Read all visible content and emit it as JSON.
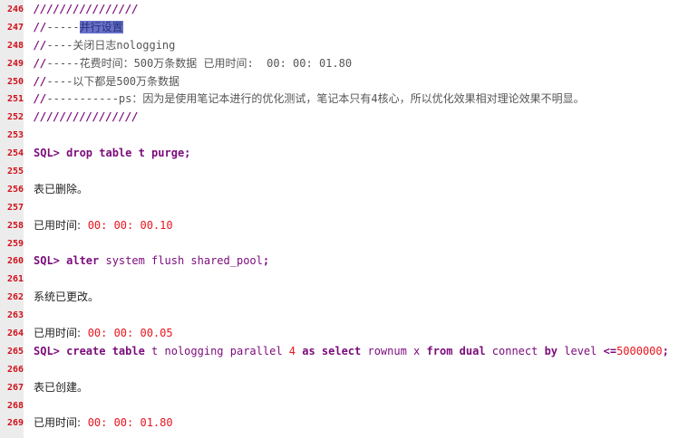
{
  "colors": {
    "keyword": "#7b0b7b",
    "number": "#e8141e",
    "line_number": "#d0101a",
    "gutter": "#ececec",
    "selection": "#6671c9"
  },
  "lines": [
    {
      "n": "246",
      "seg": [
        [
          "cm",
          "////////////////"
        ]
      ]
    },
    {
      "n": "247",
      "seg": [
        [
          "cm",
          "//"
        ],
        [
          "ct",
          "-----"
        ],
        [
          "hl",
          "并行设置"
        ]
      ]
    },
    {
      "n": "248",
      "seg": [
        [
          "cm",
          "//"
        ],
        [
          "ct",
          "----关闭日志nologging"
        ]
      ]
    },
    {
      "n": "249",
      "seg": [
        [
          "cm",
          "//"
        ],
        [
          "ct",
          "-----花费时间：500万条数据 已用时间:  00: 00: 01.80"
        ]
      ]
    },
    {
      "n": "250",
      "seg": [
        [
          "cm",
          "//"
        ],
        [
          "ct",
          "----以下都是500万条数据"
        ]
      ]
    },
    {
      "n": "251",
      "seg": [
        [
          "cm",
          "//"
        ],
        [
          "ct",
          "-----------ps：因为是使用笔记本进行的优化测试，笔记本只有4核心，所以优化效果相对理论效果不明显。"
        ]
      ]
    },
    {
      "n": "252",
      "seg": [
        [
          "cm",
          "////////////////"
        ]
      ]
    },
    {
      "n": "253",
      "seg": []
    },
    {
      "n": "254",
      "seg": [
        [
          "kw",
          "SQL> drop table t purge;"
        ]
      ]
    },
    {
      "n": "255",
      "seg": []
    },
    {
      "n": "256",
      "seg": [
        [
          "pl",
          "表已删除。"
        ]
      ]
    },
    {
      "n": "257",
      "seg": []
    },
    {
      "n": "258",
      "seg": [
        [
          "pl",
          "已用时间:  "
        ],
        [
          "num",
          "00: 00: 00.10"
        ]
      ]
    },
    {
      "n": "259",
      "seg": []
    },
    {
      "n": "260",
      "seg": [
        [
          "kw",
          "SQL> alter "
        ],
        [
          "id",
          "system flush shared_pool"
        ],
        [
          "kw",
          ";"
        ]
      ]
    },
    {
      "n": "261",
      "seg": []
    },
    {
      "n": "262",
      "seg": [
        [
          "pl",
          "系统已更改。"
        ]
      ]
    },
    {
      "n": "263",
      "seg": []
    },
    {
      "n": "264",
      "seg": [
        [
          "pl",
          "已用时间:  "
        ],
        [
          "num",
          "00: 00: 00.05"
        ]
      ]
    },
    {
      "n": "265",
      "seg": [
        [
          "kw",
          "SQL> create table "
        ],
        [
          "id",
          "t nologging parallel "
        ],
        [
          "num",
          "4"
        ],
        [
          "kw",
          " as select "
        ],
        [
          "id",
          "rownum x "
        ],
        [
          "kw",
          "from dual "
        ],
        [
          "id",
          "connect "
        ],
        [
          "kw",
          "by "
        ],
        [
          "id",
          "level "
        ],
        [
          "kw",
          "<="
        ],
        [
          "num",
          "5000000"
        ],
        [
          "kw",
          ";"
        ]
      ]
    },
    {
      "n": "266",
      "seg": []
    },
    {
      "n": "267",
      "seg": [
        [
          "pl",
          "表已创建。"
        ]
      ]
    },
    {
      "n": "268",
      "seg": []
    },
    {
      "n": "269",
      "seg": [
        [
          "pl",
          "已用时间:  "
        ],
        [
          "num",
          "00: 00: 01.80"
        ]
      ]
    }
  ]
}
